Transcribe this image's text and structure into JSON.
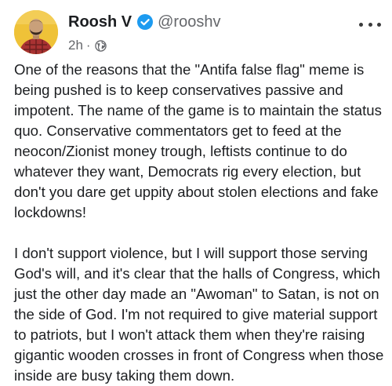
{
  "author": {
    "name": "Roosh V",
    "handle": "@rooshv",
    "verified": true,
    "avatar_colors": {
      "background": "#efc238",
      "shirt": "#a83232",
      "skin": "#c9a07a"
    }
  },
  "meta": {
    "timestamp": "2h",
    "separator": "·",
    "audience_icon": "globe-icon"
  },
  "menu": {
    "icon": "more-options-icon"
  },
  "post": {
    "paragraphs": [
      "One of the reasons that the \"Antifa false flag\" meme is being pushed is to keep conservatives passive and impotent. The name of the game is to maintain the status quo. Conservative commentators get to feed at the neocon/Zionist money trough, leftists continue to do whatever they want, Democrats rig every election, but don't you dare get uppity about stolen elections and fake lockdowns!",
      "I don't support violence, but I will support those serving God's will, and it's clear that the halls of Congress, which just the other day made an \"Awoman\" to Satan, is not on the side of God. I'm not required to give material support to patriots, but I won't attack them when they're raising gigantic wooden crosses in front of Congress when those inside are busy taking them down."
    ]
  },
  "colors": {
    "verified_badge": "#1d9bf0",
    "text": "#1c1e21",
    "secondary_text": "#65676b"
  }
}
